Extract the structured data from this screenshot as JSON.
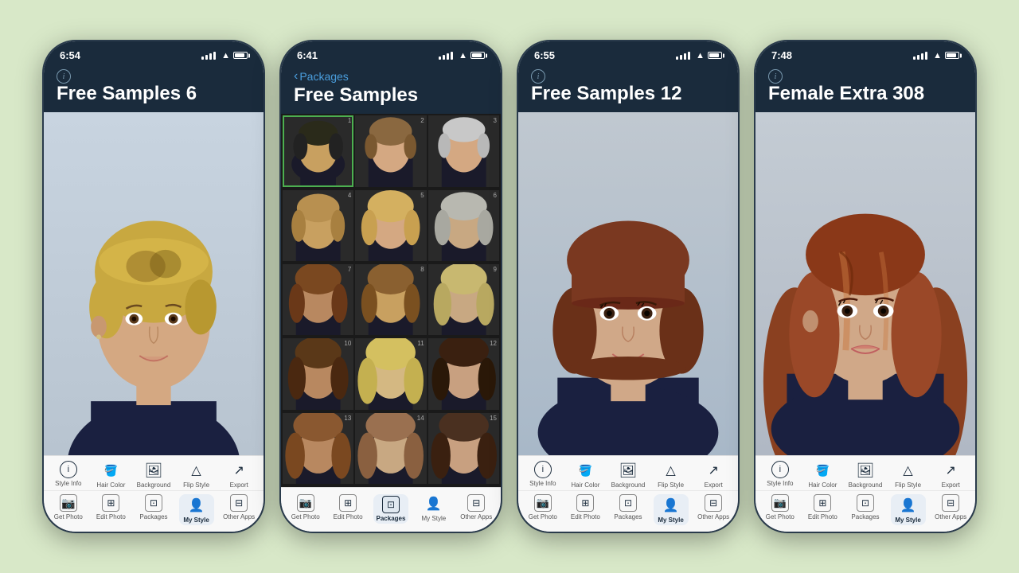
{
  "background": "#d8e8c8",
  "phones": [
    {
      "id": "phone1",
      "time": "6:54",
      "title": "Free Samples 6",
      "has_back": false,
      "content_type": "portrait",
      "hair_style": "short_blonde_pixie",
      "active_tab_bottom": "my_style",
      "toolbar_top": [
        "Style Info",
        "Hair Color",
        "Background",
        "Flip Style",
        "Export"
      ],
      "toolbar_bottom": [
        "Get Photo",
        "Edit Photo",
        "Packages",
        "My Style",
        "Other Apps"
      ]
    },
    {
      "id": "phone2",
      "time": "6:41",
      "title": "Free Samples",
      "has_back": true,
      "back_label": "Packages",
      "content_type": "grid",
      "selected_cell": 1,
      "grid_count": 15,
      "active_tab_bottom": "packages",
      "toolbar_top": [
        "Get Photo",
        "Edit Photo",
        "Packages",
        "My Style",
        "Other Apps"
      ],
      "toolbar_bottom": []
    },
    {
      "id": "phone3",
      "time": "6:55",
      "title": "Free Samples 12",
      "has_back": false,
      "content_type": "portrait",
      "hair_style": "bob_bangs_brunette",
      "active_tab_bottom": "my_style",
      "toolbar_top": [
        "Style Info",
        "Hair Color",
        "Background",
        "Flip Style",
        "Export"
      ],
      "toolbar_bottom": [
        "Get Photo",
        "Edit Photo",
        "Packages",
        "My Style",
        "Other Apps"
      ]
    },
    {
      "id": "phone4",
      "time": "7:48",
      "title": "Female Extra 308",
      "has_back": false,
      "content_type": "portrait",
      "hair_style": "long_auburn_layered",
      "active_tab_bottom": "my_style",
      "toolbar_top": [
        "Style Info",
        "Hair Color",
        "Background",
        "Flip Style",
        "Export"
      ],
      "toolbar_bottom": [
        "Get Photo",
        "Edit Photo",
        "Packages",
        "My Style",
        "Other Apps"
      ]
    }
  ],
  "toolbar_icons": {
    "style_info": "ℹ",
    "hair_color": "🪣",
    "background": "🖼",
    "flip_style": "△",
    "export": "↗",
    "get_photo": "📷",
    "edit_photo": "⊞",
    "packages": "⊡",
    "my_style": "👤",
    "other_apps": "⊟"
  }
}
